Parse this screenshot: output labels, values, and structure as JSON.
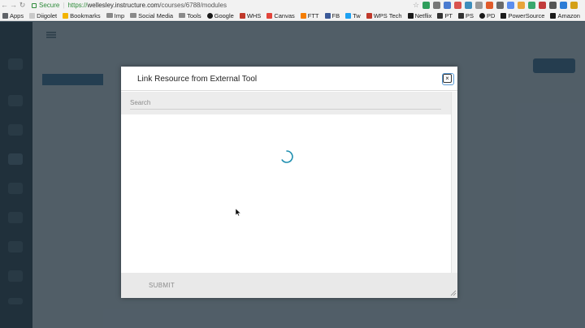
{
  "browser": {
    "secure_label": "Secure",
    "url_scheme": "https://",
    "url_host": "wellesley.instructure.com",
    "url_path": "/courses/6788/modules",
    "bookmarks": [
      {
        "label": "Apps",
        "icon": "apps-grid-icon",
        "color": "#5f6368"
      },
      {
        "label": "Diigolet",
        "icon": "page-icon",
        "color": "#c9c9c9"
      },
      {
        "label": "Bookmarks",
        "icon": "star-icon",
        "color": "#f3b400"
      },
      {
        "label": "Imp",
        "icon": "folder-icon",
        "color": "#8a8a8a"
      },
      {
        "label": "Social Media",
        "icon": "folder-icon",
        "color": "#8a8a8a"
      },
      {
        "label": "Tools",
        "icon": "folder-icon",
        "color": "#8a8a8a"
      },
      {
        "label": "Google",
        "icon": "google-icon",
        "color": "#1a1a1a"
      },
      {
        "label": "WHS",
        "icon": "globe-icon",
        "color": "#c0392b"
      },
      {
        "label": "Canvas",
        "icon": "canvas-icon",
        "color": "#e2443b"
      },
      {
        "label": "FTT",
        "icon": "blogger-icon",
        "color": "#f57d00"
      },
      {
        "label": "FB",
        "icon": "facebook-icon",
        "color": "#3b5998"
      },
      {
        "label": "Tw",
        "icon": "twitter-icon",
        "color": "#1da1f2"
      },
      {
        "label": "WPS Tech",
        "icon": "wps-icon",
        "color": "#c0392b"
      },
      {
        "label": "Netflix",
        "icon": "netflix-icon",
        "color": "#1a1a1a"
      },
      {
        "label": "PT",
        "icon": "pt-icon",
        "color": "#333333"
      },
      {
        "label": "PS",
        "icon": "ps-icon",
        "color": "#333333"
      },
      {
        "label": "PD",
        "icon": "google-icon",
        "color": "#1a1a1a"
      },
      {
        "label": "PowerSource",
        "icon": "power-icon",
        "color": "#1a1a1a"
      },
      {
        "label": "Amazon",
        "icon": "amazon-icon",
        "color": "#1a1a1a"
      }
    ]
  },
  "modal": {
    "title": "Link Resource from External Tool",
    "close_label": "×",
    "search_placeholder": "Search",
    "submit_label": "SUBMIT"
  },
  "colors": {
    "spinner": "#1f8fb0",
    "overlay": "#1c2c38",
    "global_nav": "#2d3b45",
    "accent_blue": "#3d6a8c"
  }
}
